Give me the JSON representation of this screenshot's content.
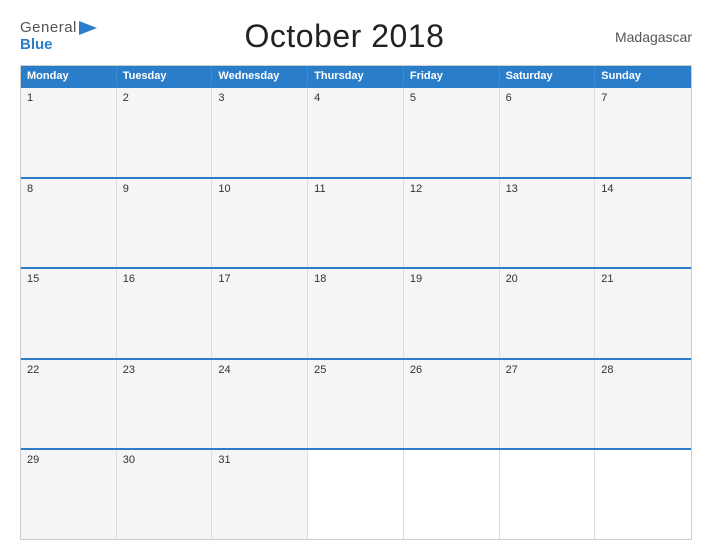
{
  "header": {
    "logo_general": "General",
    "logo_blue": "Blue",
    "title": "October 2018",
    "country": "Madagascar"
  },
  "days_header": [
    "Monday",
    "Tuesday",
    "Wednesday",
    "Thursday",
    "Friday",
    "Saturday",
    "Sunday"
  ],
  "weeks": [
    [
      {
        "n": "1",
        "e": false
      },
      {
        "n": "2",
        "e": false
      },
      {
        "n": "3",
        "e": false
      },
      {
        "n": "4",
        "e": false
      },
      {
        "n": "5",
        "e": false
      },
      {
        "n": "6",
        "e": false
      },
      {
        "n": "7",
        "e": false
      }
    ],
    [
      {
        "n": "8",
        "e": false
      },
      {
        "n": "9",
        "e": false
      },
      {
        "n": "10",
        "e": false
      },
      {
        "n": "11",
        "e": false
      },
      {
        "n": "12",
        "e": false
      },
      {
        "n": "13",
        "e": false
      },
      {
        "n": "14",
        "e": false
      }
    ],
    [
      {
        "n": "15",
        "e": false
      },
      {
        "n": "16",
        "e": false
      },
      {
        "n": "17",
        "e": false
      },
      {
        "n": "18",
        "e": false
      },
      {
        "n": "19",
        "e": false
      },
      {
        "n": "20",
        "e": false
      },
      {
        "n": "21",
        "e": false
      }
    ],
    [
      {
        "n": "22",
        "e": false
      },
      {
        "n": "23",
        "e": false
      },
      {
        "n": "24",
        "e": false
      },
      {
        "n": "25",
        "e": false
      },
      {
        "n": "26",
        "e": false
      },
      {
        "n": "27",
        "e": false
      },
      {
        "n": "28",
        "e": false
      }
    ],
    [
      {
        "n": "29",
        "e": false
      },
      {
        "n": "30",
        "e": false
      },
      {
        "n": "31",
        "e": false
      },
      {
        "n": "",
        "e": true
      },
      {
        "n": "",
        "e": true
      },
      {
        "n": "",
        "e": true
      },
      {
        "n": "",
        "e": true
      }
    ]
  ]
}
